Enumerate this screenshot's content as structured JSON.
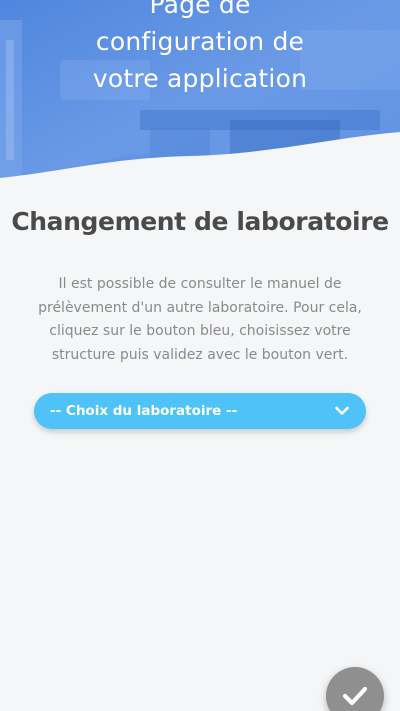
{
  "hero": {
    "title_lines": [
      "Page de",
      "configuration de",
      "votre application"
    ]
  },
  "main": {
    "heading": "Changement de laboratoire",
    "description": "Il est possible de consulter le manuel de prélèvement d'un autre laboratoire. Pour cela, cliquez sur le bouton bleu, choisissez votre structure puis validez avec le bouton vert.",
    "lab_select": {
      "selected_label": "-- Choix du laboratoire --",
      "icon": "chevron-down-icon"
    }
  },
  "actions": {
    "validate_icon": "checkmark-icon"
  },
  "colors": {
    "accent_blue": "#4fc3f7",
    "hero_blue": "#5b8fe0",
    "background": "#f4f6f7",
    "heading": "#4a4a4a",
    "text": "#8a8a8a",
    "validate_button": "#8f8f8f"
  }
}
